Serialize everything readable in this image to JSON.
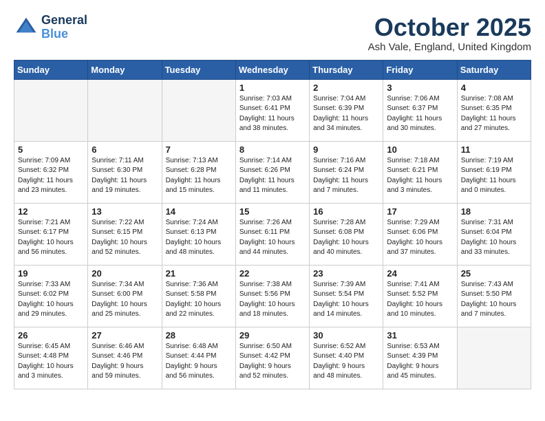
{
  "logo": {
    "line1": "General",
    "line2": "Blue"
  },
  "title": "October 2025",
  "location": "Ash Vale, England, United Kingdom",
  "days_of_week": [
    "Sunday",
    "Monday",
    "Tuesday",
    "Wednesday",
    "Thursday",
    "Friday",
    "Saturday"
  ],
  "weeks": [
    [
      {
        "day": "",
        "info": ""
      },
      {
        "day": "",
        "info": ""
      },
      {
        "day": "",
        "info": ""
      },
      {
        "day": "1",
        "info": "Sunrise: 7:03 AM\nSunset: 6:41 PM\nDaylight: 11 hours\nand 38 minutes."
      },
      {
        "day": "2",
        "info": "Sunrise: 7:04 AM\nSunset: 6:39 PM\nDaylight: 11 hours\nand 34 minutes."
      },
      {
        "day": "3",
        "info": "Sunrise: 7:06 AM\nSunset: 6:37 PM\nDaylight: 11 hours\nand 30 minutes."
      },
      {
        "day": "4",
        "info": "Sunrise: 7:08 AM\nSunset: 6:35 PM\nDaylight: 11 hours\nand 27 minutes."
      }
    ],
    [
      {
        "day": "5",
        "info": "Sunrise: 7:09 AM\nSunset: 6:32 PM\nDaylight: 11 hours\nand 23 minutes."
      },
      {
        "day": "6",
        "info": "Sunrise: 7:11 AM\nSunset: 6:30 PM\nDaylight: 11 hours\nand 19 minutes."
      },
      {
        "day": "7",
        "info": "Sunrise: 7:13 AM\nSunset: 6:28 PM\nDaylight: 11 hours\nand 15 minutes."
      },
      {
        "day": "8",
        "info": "Sunrise: 7:14 AM\nSunset: 6:26 PM\nDaylight: 11 hours\nand 11 minutes."
      },
      {
        "day": "9",
        "info": "Sunrise: 7:16 AM\nSunset: 6:24 PM\nDaylight: 11 hours\nand 7 minutes."
      },
      {
        "day": "10",
        "info": "Sunrise: 7:18 AM\nSunset: 6:21 PM\nDaylight: 11 hours\nand 3 minutes."
      },
      {
        "day": "11",
        "info": "Sunrise: 7:19 AM\nSunset: 6:19 PM\nDaylight: 11 hours\nand 0 minutes."
      }
    ],
    [
      {
        "day": "12",
        "info": "Sunrise: 7:21 AM\nSunset: 6:17 PM\nDaylight: 10 hours\nand 56 minutes."
      },
      {
        "day": "13",
        "info": "Sunrise: 7:22 AM\nSunset: 6:15 PM\nDaylight: 10 hours\nand 52 minutes."
      },
      {
        "day": "14",
        "info": "Sunrise: 7:24 AM\nSunset: 6:13 PM\nDaylight: 10 hours\nand 48 minutes."
      },
      {
        "day": "15",
        "info": "Sunrise: 7:26 AM\nSunset: 6:11 PM\nDaylight: 10 hours\nand 44 minutes."
      },
      {
        "day": "16",
        "info": "Sunrise: 7:28 AM\nSunset: 6:08 PM\nDaylight: 10 hours\nand 40 minutes."
      },
      {
        "day": "17",
        "info": "Sunrise: 7:29 AM\nSunset: 6:06 PM\nDaylight: 10 hours\nand 37 minutes."
      },
      {
        "day": "18",
        "info": "Sunrise: 7:31 AM\nSunset: 6:04 PM\nDaylight: 10 hours\nand 33 minutes."
      }
    ],
    [
      {
        "day": "19",
        "info": "Sunrise: 7:33 AM\nSunset: 6:02 PM\nDaylight: 10 hours\nand 29 minutes."
      },
      {
        "day": "20",
        "info": "Sunrise: 7:34 AM\nSunset: 6:00 PM\nDaylight: 10 hours\nand 25 minutes."
      },
      {
        "day": "21",
        "info": "Sunrise: 7:36 AM\nSunset: 5:58 PM\nDaylight: 10 hours\nand 22 minutes."
      },
      {
        "day": "22",
        "info": "Sunrise: 7:38 AM\nSunset: 5:56 PM\nDaylight: 10 hours\nand 18 minutes."
      },
      {
        "day": "23",
        "info": "Sunrise: 7:39 AM\nSunset: 5:54 PM\nDaylight: 10 hours\nand 14 minutes."
      },
      {
        "day": "24",
        "info": "Sunrise: 7:41 AM\nSunset: 5:52 PM\nDaylight: 10 hours\nand 10 minutes."
      },
      {
        "day": "25",
        "info": "Sunrise: 7:43 AM\nSunset: 5:50 PM\nDaylight: 10 hours\nand 7 minutes."
      }
    ],
    [
      {
        "day": "26",
        "info": "Sunrise: 6:45 AM\nSunset: 4:48 PM\nDaylight: 10 hours\nand 3 minutes."
      },
      {
        "day": "27",
        "info": "Sunrise: 6:46 AM\nSunset: 4:46 PM\nDaylight: 9 hours\nand 59 minutes."
      },
      {
        "day": "28",
        "info": "Sunrise: 6:48 AM\nSunset: 4:44 PM\nDaylight: 9 hours\nand 56 minutes."
      },
      {
        "day": "29",
        "info": "Sunrise: 6:50 AM\nSunset: 4:42 PM\nDaylight: 9 hours\nand 52 minutes."
      },
      {
        "day": "30",
        "info": "Sunrise: 6:52 AM\nSunset: 4:40 PM\nDaylight: 9 hours\nand 48 minutes."
      },
      {
        "day": "31",
        "info": "Sunrise: 6:53 AM\nSunset: 4:39 PM\nDaylight: 9 hours\nand 45 minutes."
      },
      {
        "day": "",
        "info": ""
      }
    ]
  ]
}
